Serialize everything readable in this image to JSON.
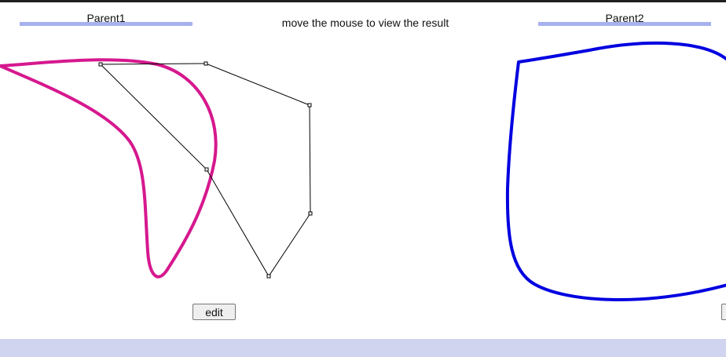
{
  "parents": [
    {
      "label": "Parent1",
      "bar_color": "#a6b1ef"
    },
    {
      "label": "Parent2",
      "bar_color": "#a6b1ef"
    }
  ],
  "instruction": "move the mouse to view the result",
  "edit_button_label": "edit",
  "colors": {
    "curve_left": "#d6188e",
    "curve_right": "#0000e0",
    "control_polygon": "#000000",
    "footer": "#d1d4ef"
  },
  "icons": {
    "control_point": "small-square-handle"
  }
}
